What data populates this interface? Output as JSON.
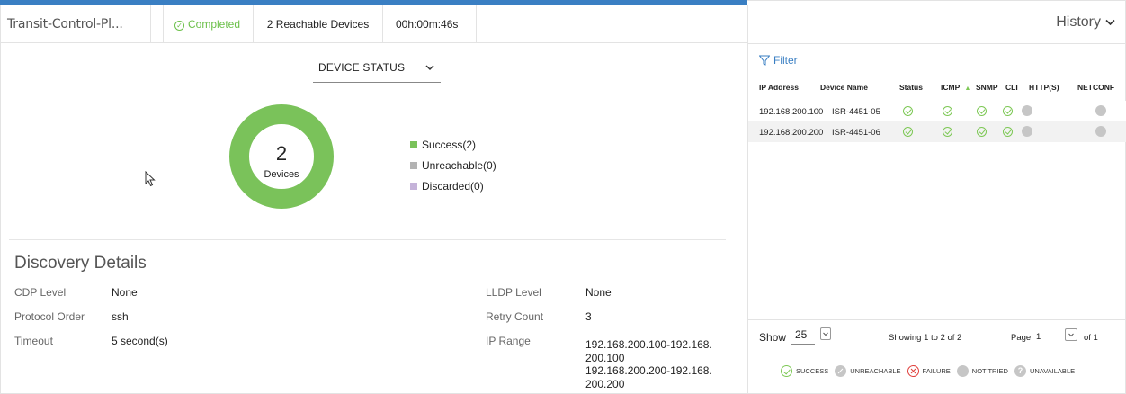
{
  "topbar": {
    "title": "Transit-Control-Pl...",
    "status": "Completed",
    "reachable": "2 Reachable Devices",
    "elapsed": "00h:00m:46s"
  },
  "device_status": {
    "dropdown_label": "DEVICE STATUS",
    "total": "2",
    "total_label": "Devices",
    "legend": [
      {
        "label": "Success(2)",
        "color": "#7ac25a",
        "count": 2
      },
      {
        "label": "Unreachable(0)",
        "color": "#b3b3b3",
        "count": 0
      },
      {
        "label": "Discarded(0)",
        "color": "#c5b3d9",
        "count": 0
      }
    ]
  },
  "discovery": {
    "title": "Discovery Details",
    "cdp_level_label": "CDP Level",
    "cdp_level": "None",
    "protocol_order_label": "Protocol Order",
    "protocol_order": "ssh",
    "timeout_label": "Timeout",
    "timeout": "5 second(s)",
    "lldp_level_label": "LLDP Level",
    "lldp_level": "None",
    "retry_count_label": "Retry Count",
    "retry_count": "3",
    "ip_range_label": "IP Range",
    "ip_range_lines": [
      "192.168.200.100-192.168.",
      "200.100",
      "192.168.200.200-192.168.",
      "200.200"
    ]
  },
  "history": {
    "label": "History",
    "filter_label": "Filter",
    "columns": [
      "IP Address",
      "Device Name",
      "Status",
      "ICMP",
      "SNMP",
      "CLI",
      "HTTP(S)",
      "NETCONF"
    ],
    "sort_indicator": "▲",
    "rows": [
      {
        "ip": "192.168.200.100",
        "name": "ISR-4451-05",
        "status": "success",
        "icmp": "success",
        "snmp": "success",
        "cli": "success",
        "https": "not tried",
        "netconf": "not tried"
      },
      {
        "ip": "192.168.200.200",
        "name": "ISR-4451-06",
        "status": "success",
        "icmp": "success",
        "snmp": "success",
        "cli": "success",
        "https": "not tried",
        "netconf": "not tried"
      }
    ],
    "pager": {
      "show_label": "Show",
      "page_size": "25",
      "showing": "Showing 1 to 2 of 2",
      "page_label": "Page",
      "page": "1",
      "of": "of 1"
    },
    "status_keys": {
      "success": "SUCCESS",
      "unreachable": "UNREACHABLE",
      "failure": "FAILURE",
      "not_tried": "NOT TRIED",
      "unavailable": "UNAVAILABLE"
    }
  },
  "colors": {
    "accent_blue": "#3a7fc3",
    "success_green": "#7ac25a",
    "failure_red": "#e0403d",
    "neutral_grey": "#c6c6c6"
  }
}
